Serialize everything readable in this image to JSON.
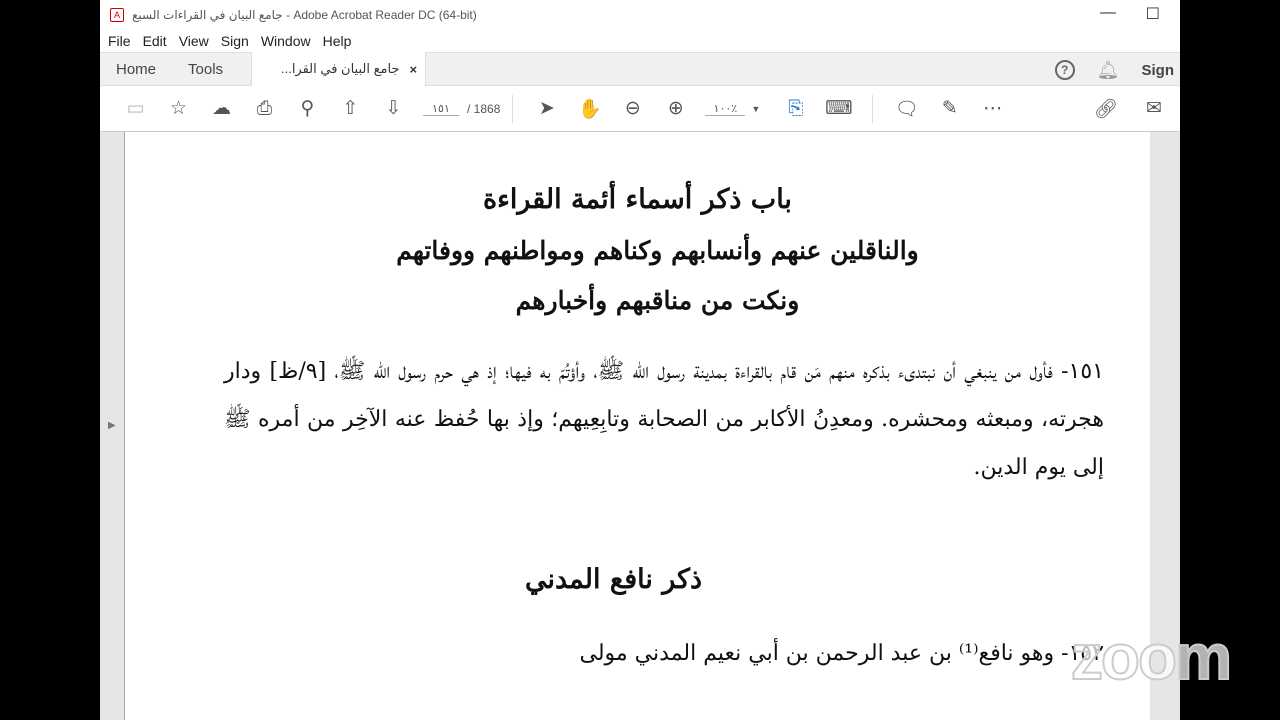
{
  "window": {
    "title": "جامع البيان في القراءات السبع - Adobe Acrobat Reader DC (64-bit)"
  },
  "menu": [
    "File",
    "Edit",
    "View",
    "Sign",
    "Window",
    "Help"
  ],
  "tabs": {
    "home": "Home",
    "tools": "Tools",
    "document": "جامع البيان في القرا...",
    "close": "×",
    "help": "?",
    "sign": "Sign"
  },
  "toolbar": {
    "page_current": "١٥١",
    "page_total": "/ 1868",
    "zoom": "١٠٠٪"
  },
  "document": {
    "heading1": "باب ذكر أسماء أئمة القراءة",
    "heading2": "والناقلين عنهم وأنسابهم وكناهم ومواطنهم ووفاتهم",
    "heading3": "ونكت من مناقبهم وأخبارهم",
    "paragraph1": "١٥١- فأول من ينبغي أن نبتدىء بذكره منهم مَن قام بالقراءة بمدينة رسول الله ﷺ، وأؤتُمّ به فيها؛ إذ هي حرم رسول الله ﷺ، [٩/ظ] ودار هجرته، ومبعثه ومحشره. ومعدِنُ الأكابر من الصحابة وتابِعِيهم؛ وإذ بها حُفظ عنه الآخِر من أمره ﷺ إلى يوم الدين.",
    "section": "ذكر نافع المدني",
    "paragraph2": "١٥٢- وهو نافع⁽¹⁾ بن عبد الرحمن بن أبي نعيم المدني مولى"
  },
  "watermark": "zoom"
}
